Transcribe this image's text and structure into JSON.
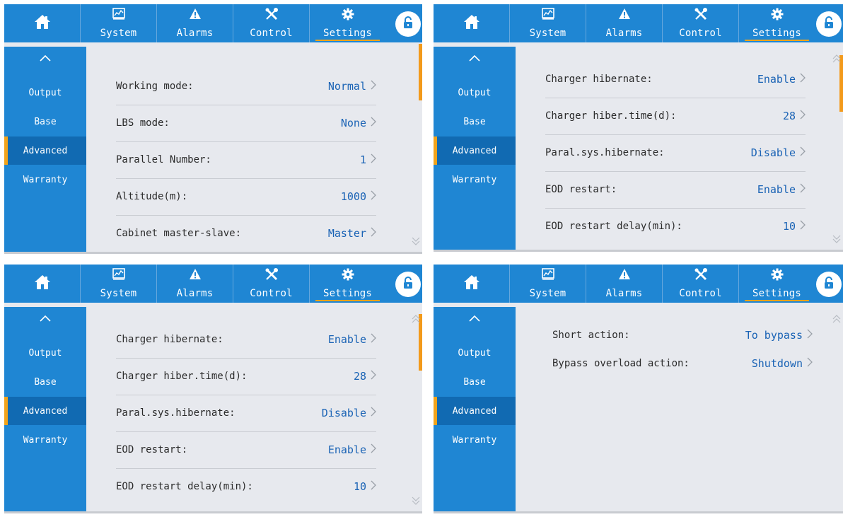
{
  "tabs": {
    "home": "",
    "system": "System",
    "alarms": "Alarms",
    "control": "Control",
    "settings": "Settings"
  },
  "sidebar": {
    "items": [
      {
        "label": "Output"
      },
      {
        "label": "Base"
      },
      {
        "label": "Advanced"
      },
      {
        "label": "Warranty"
      }
    ],
    "active": "Advanced"
  },
  "colors": {
    "topbar": "#1f86d3",
    "accent": "#f2a31b",
    "value_text": "#1a63b5",
    "sidebar_active": "#116ab2"
  },
  "icons": [
    "home-icon",
    "system-chart-icon",
    "alarm-warning-icon",
    "control-tools-icon",
    "settings-gear-icon",
    "unlock-icon",
    "chevron-up-icon",
    "chevron-right-icon",
    "double-chevron-up-icon",
    "double-chevron-down-icon"
  ],
  "panels": [
    {
      "rows": [
        {
          "label": "Working mode:",
          "value": "Normal"
        },
        {
          "label": "LBS mode:",
          "value": "None"
        },
        {
          "label": "Parallel Number:",
          "value": "1"
        },
        {
          "label": "Altitude(m):",
          "value": "1000"
        },
        {
          "label": "Cabinet master-slave:",
          "value": "Master"
        }
      ]
    },
    {
      "rows": [
        {
          "label": "Charger hibernate:",
          "value": "Enable"
        },
        {
          "label": "Charger hiber.time(d):",
          "value": "28"
        },
        {
          "label": "Paral.sys.hibernate:",
          "value": "Disable"
        },
        {
          "label": "EOD restart:",
          "value": "Enable"
        },
        {
          "label": "EOD restart delay(min):",
          "value": "10"
        }
      ]
    },
    {
      "rows": [
        {
          "label": "Charger hibernate:",
          "value": "Enable"
        },
        {
          "label": "Charger hiber.time(d):",
          "value": "28"
        },
        {
          "label": "Paral.sys.hibernate:",
          "value": "Disable"
        },
        {
          "label": "EOD restart:",
          "value": "Enable"
        },
        {
          "label": "EOD restart delay(min):",
          "value": "10"
        }
      ]
    },
    {
      "rows": [
        {
          "label": "Short action:",
          "value": "To bypass"
        },
        {
          "label": "Bypass overload action:",
          "value": "Shutdown"
        }
      ]
    }
  ]
}
